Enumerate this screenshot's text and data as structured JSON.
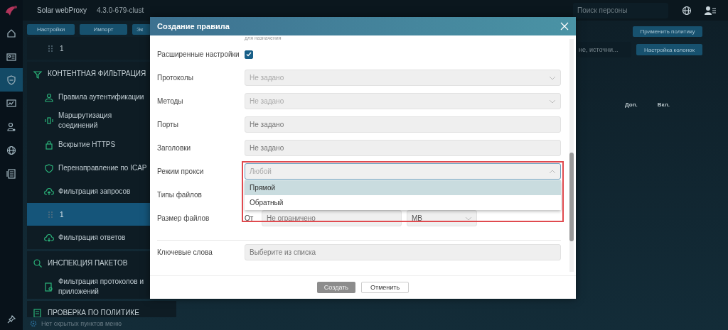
{
  "app": {
    "name": "Solar webProxy",
    "version": "4.3.0-679-clust"
  },
  "rail": [
    {
      "selected": false
    },
    {
      "selected": false
    },
    {
      "selected": true
    },
    {
      "selected": false
    },
    {
      "selected": false
    },
    {
      "selected": false
    },
    {
      "selected": false
    }
  ],
  "header": {
    "search_placeholder": "Поиск персоны"
  },
  "toolbar_buttons": [
    "Настройки",
    "Импорт",
    "Эк"
  ],
  "top_rules": [
    {
      "label": "1",
      "selected": false
    }
  ],
  "sections": [
    {
      "title": "КОНТЕНТНАЯ ФИЛЬТРАЦИЯ",
      "items": [
        {
          "label": "Правила аутентификации"
        },
        {
          "label": "Маршрутизация соединений"
        },
        {
          "label": "Вскрытие HTTPS"
        },
        {
          "label": "Перенаправление по ICAP"
        },
        {
          "label": "Фильтрация запросов",
          "children": [
            {
              "label": "1",
              "selected": true
            }
          ]
        },
        {
          "label": "Фильтрация ответов"
        }
      ]
    },
    {
      "title": "ИНСПЕКЦИЯ ПАКЕТОВ",
      "items": [
        {
          "label": "Фильтрация протоколов и приложений"
        }
      ]
    },
    {
      "title": "ПРОВЕРКА ПО ПОЛИТИКЕ"
    }
  ],
  "hidden_menu_note": "Нет скрытых пунктов меню",
  "right": {
    "apply_button": "Применить политику",
    "search_placeholder": "не, источни...",
    "columns_button": "Настройка колонок",
    "columns": [
      "Доп.",
      "Вкл."
    ]
  },
  "modal": {
    "title": "Создание правила",
    "cut_hint": "для назначения",
    "fields": [
      {
        "kind": "checkbox",
        "label": "Расширенные настройки",
        "checked": true
      },
      {
        "kind": "select",
        "label": "Протоколы",
        "placeholder": "Не задано",
        "expanded": false
      },
      {
        "kind": "select",
        "label": "Методы",
        "placeholder": "Не задано",
        "expanded": false
      },
      {
        "kind": "text",
        "label": "Порты",
        "placeholder": "Не задано"
      },
      {
        "kind": "text",
        "label": "Заголовки",
        "placeholder": "Не задано"
      },
      {
        "kind": "select",
        "label": "Режим прокси",
        "placeholder": "Любой",
        "expanded": true,
        "highlighted": true,
        "options": [
          {
            "label": "Прямой",
            "selected": true
          },
          {
            "label": "Обратный",
            "selected": false
          }
        ]
      },
      {
        "kind": "label",
        "label": "Типы файлов"
      },
      {
        "kind": "size",
        "label": "Размер файлов",
        "from_label": "От",
        "placeholder": "Не ограничено",
        "unit": "MB"
      },
      {
        "kind": "divider"
      },
      {
        "kind": "text",
        "label": "Ключевые слова",
        "placeholder": "Выберите из списка"
      }
    ],
    "buttons": [
      {
        "label": "Создать",
        "kind": "primary",
        "disabled": true
      },
      {
        "label": "Отменить",
        "kind": "secondary",
        "disabled": false
      }
    ]
  }
}
